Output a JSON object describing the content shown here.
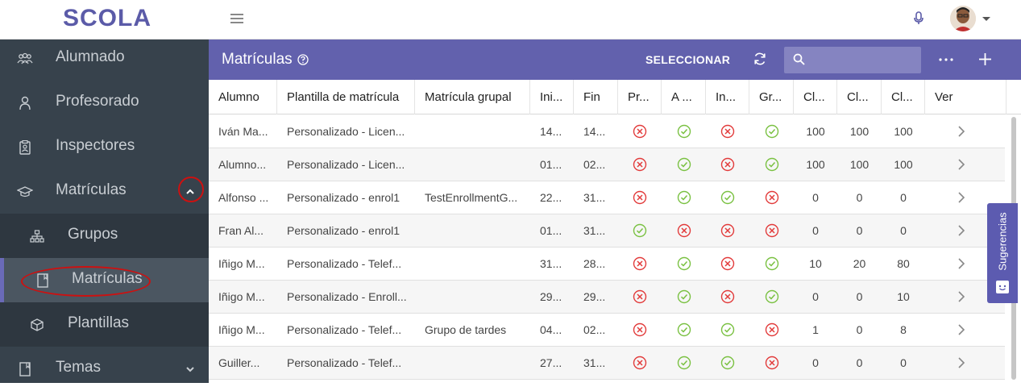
{
  "app": {
    "logo_text": "SCOLA"
  },
  "sidebar": {
    "items": [
      {
        "label": "Alumnado",
        "icon": "students-icon"
      },
      {
        "label": "Profesorado",
        "icon": "person-icon"
      },
      {
        "label": "Inspectores",
        "icon": "badge-icon"
      },
      {
        "label": "Matrículas",
        "icon": "graduation-cap-icon",
        "expanded": true
      },
      {
        "label": "Grupos",
        "icon": "hierarchy-icon"
      },
      {
        "label": "Matrículas",
        "icon": "book-icon",
        "active": true
      },
      {
        "label": "Plantillas",
        "icon": "cube-icon"
      },
      {
        "label": "Temas",
        "icon": "book-icon"
      }
    ]
  },
  "header": {
    "title": "Matrículas",
    "select_label": "SELECCIONAR",
    "search_placeholder": "",
    "search_value": ""
  },
  "colors": {
    "primary": "#6261ad",
    "sidebar": "#37424c",
    "ok": "#7ac142",
    "error": "#e23b3b"
  },
  "table": {
    "columns": [
      "Alumno",
      "Plantilla de matrícula",
      "Matrícula grupal",
      "Ini...",
      "Fin",
      "Pr...",
      "A ...",
      "In...",
      "Gr...",
      "Cl...",
      "Cl...",
      "Cl...",
      "Ver"
    ],
    "rows": [
      {
        "alumno": "Iván Ma...",
        "plantilla": "Personalizado - Licen...",
        "grupal": "",
        "ini": "14...",
        "fin": "14...",
        "pr": "error",
        "a": "ok",
        "in": "error",
        "gr": "ok",
        "c1": "100",
        "c2": "100",
        "c3": "100"
      },
      {
        "alumno": "Alumno...",
        "plantilla": "Personalizado - Licen...",
        "grupal": "",
        "ini": "01...",
        "fin": "02...",
        "pr": "error",
        "a": "ok",
        "in": "error",
        "gr": "ok",
        "c1": "100",
        "c2": "100",
        "c3": "100"
      },
      {
        "alumno": "Alfonso ...",
        "plantilla": "Personalizado - enrol1",
        "grupal": "TestEnrollmentG...",
        "ini": "22...",
        "fin": "31...",
        "pr": "error",
        "a": "ok",
        "in": "ok",
        "gr": "error",
        "c1": "0",
        "c2": "0",
        "c3": "0"
      },
      {
        "alumno": "Fran Al...",
        "plantilla": "Personalizado - enrol1",
        "grupal": "",
        "ini": "01...",
        "fin": "31...",
        "pr": "ok",
        "a": "error",
        "in": "error",
        "gr": "error",
        "c1": "0",
        "c2": "0",
        "c3": "0"
      },
      {
        "alumno": "Iñigo M...",
        "plantilla": "Personalizado - Telef...",
        "grupal": "",
        "ini": "31...",
        "fin": "28...",
        "pr": "error",
        "a": "ok",
        "in": "error",
        "gr": "ok",
        "c1": "10",
        "c2": "20",
        "c3": "80"
      },
      {
        "alumno": "Iñigo M...",
        "plantilla": "Personalizado - Enroll...",
        "grupal": "",
        "ini": "29...",
        "fin": "29...",
        "pr": "error",
        "a": "ok",
        "in": "error",
        "gr": "ok",
        "c1": "0",
        "c2": "0",
        "c3": "10"
      },
      {
        "alumno": "Iñigo M...",
        "plantilla": "Personalizado - Telef...",
        "grupal": "Grupo de tardes",
        "ini": "04...",
        "fin": "02...",
        "pr": "error",
        "a": "ok",
        "in": "ok",
        "gr": "error",
        "c1": "1",
        "c2": "0",
        "c3": "8"
      },
      {
        "alumno": "Guiller...",
        "plantilla": "Personalizado - Telef...",
        "grupal": "",
        "ini": "27...",
        "fin": "31...",
        "pr": "error",
        "a": "ok",
        "in": "ok",
        "gr": "error",
        "c1": "0",
        "c2": "0",
        "c3": "0"
      }
    ]
  },
  "feedback": {
    "label": "Sugerencias"
  }
}
